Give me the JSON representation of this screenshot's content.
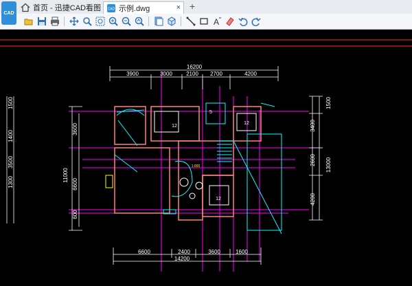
{
  "app": {
    "logo_text": "CAD"
  },
  "tabs": [
    {
      "label": "首页 - 迅捷CAD看图",
      "icon": "home-icon"
    },
    {
      "label": "示例.dwg",
      "icon": "cad-file-icon",
      "close": "×"
    }
  ],
  "new_tab_label": "+",
  "toolbar": {
    "buttons": [
      "open-icon",
      "save-icon",
      "print-icon",
      "pan-icon",
      "zoom-window-icon",
      "zoom-extents-icon",
      "zoom-in-icon",
      "zoom-out-icon",
      "zoom-previous-icon",
      "layers-icon",
      "3d-view-icon",
      "measure-icon",
      "rectangle-icon",
      "text-icon",
      "erase-icon",
      "undo-icon",
      "redo-icon"
    ]
  },
  "colors": {
    "accent": "#2f8fd8",
    "canvas": "#000000",
    "dimension": "#ffffff",
    "wall": "#ff8080",
    "aux": "#ff00ff",
    "cyan": "#00ffff"
  },
  "drawing": {
    "dims_top": {
      "total": "16200",
      "parts": [
        "3900",
        "3000",
        "2100",
        "2700",
        "4200"
      ]
    },
    "dims_bottom": {
      "total": "14200",
      "parts": [
        "6600",
        "2400",
        "3600",
        "1600"
      ]
    },
    "dims_left": {
      "total": "11000",
      "parts": [
        "3600",
        "6600",
        "600"
      ]
    },
    "dims_right": {
      "total": "13000",
      "parts": [
        "1500",
        "3400",
        "2600",
        "4200"
      ]
    },
    "dims_far_left": [
      "1500",
      "1400",
      "1300",
      "3500"
    ],
    "room_labels": [
      "12",
      "12",
      "12",
      "5"
    ],
    "small_labels": [
      "1:000"
    ]
  }
}
